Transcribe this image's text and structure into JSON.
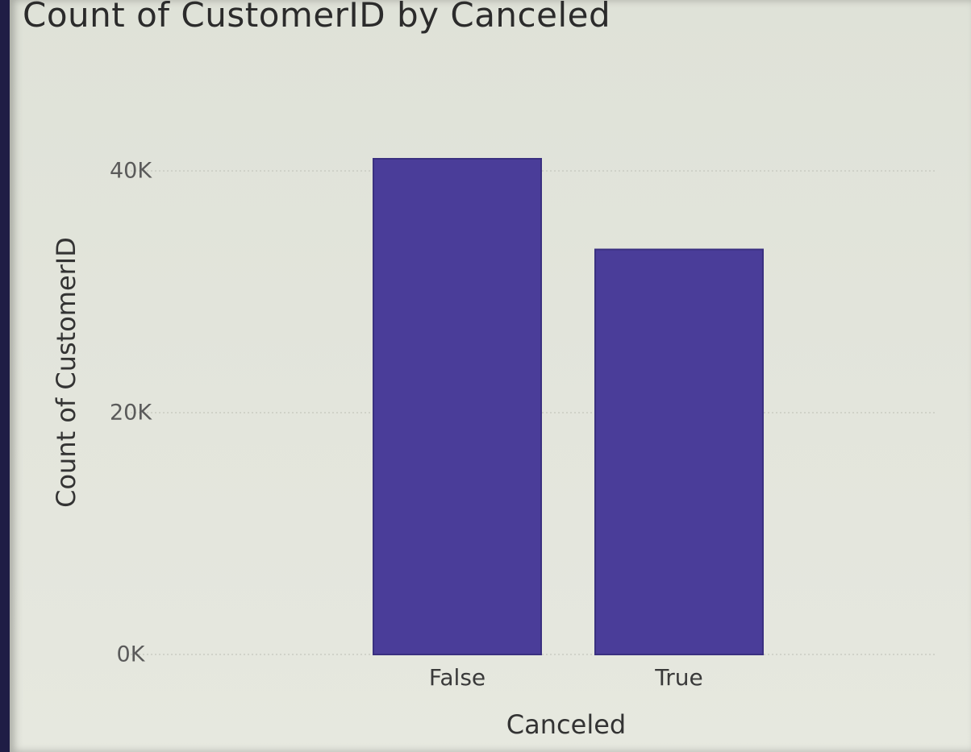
{
  "chart_data": {
    "type": "bar",
    "title": "Count of CustomerID by Canceled",
    "xlabel": "Canceled",
    "ylabel": "Count of CustomerID",
    "categories": [
      "False",
      "True"
    ],
    "values": [
      41000,
      33500
    ],
    "ylim": [
      0,
      40000
    ],
    "yticks": [
      {
        "value": 0,
        "label": "0K"
      },
      {
        "value": 20000,
        "label": "20K"
      },
      {
        "value": 40000,
        "label": "40K"
      }
    ],
    "grid": true,
    "bar_color": "#4a3d99"
  }
}
